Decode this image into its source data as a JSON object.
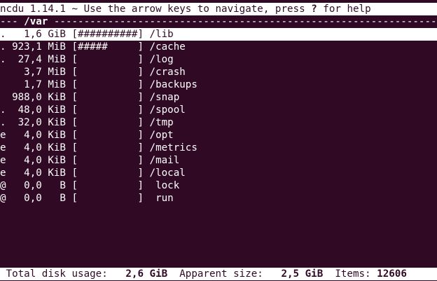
{
  "header": {
    "app": "ncdu 1.14.1",
    "sep": " ~ ",
    "hint_prefix": "Use the arrow keys to navigate, press ",
    "help_key": "?",
    "hint_suffix": " for help"
  },
  "path_bar": {
    "lead": "--- ",
    "path": "/var",
    "trail": " -------------------------------------------------------------------"
  },
  "entries": [
    {
      "flag": ".",
      "size": "  1,6 GiB",
      "bar": "[##########]",
      "name": " /lib"
    },
    {
      "flag": ".",
      "size": "923,1 MiB",
      "bar": "[#####     ]",
      "name": " /cache"
    },
    {
      "flag": ".",
      "size": " 27,4 MiB",
      "bar": "[          ]",
      "name": " /log"
    },
    {
      "flag": " ",
      "size": "  3,7 MiB",
      "bar": "[          ]",
      "name": " /crash"
    },
    {
      "flag": " ",
      "size": "  1,7 MiB",
      "bar": "[          ]",
      "name": " /backups"
    },
    {
      "flag": " ",
      "size": "988,0 KiB",
      "bar": "[          ]",
      "name": " /snap"
    },
    {
      "flag": ".",
      "size": " 48,0 KiB",
      "bar": "[          ]",
      "name": " /spool"
    },
    {
      "flag": ".",
      "size": " 32,0 KiB",
      "bar": "[          ]",
      "name": " /tmp"
    },
    {
      "flag": "e",
      "size": "  4,0 KiB",
      "bar": "[          ]",
      "name": " /opt"
    },
    {
      "flag": "e",
      "size": "  4,0 KiB",
      "bar": "[          ]",
      "name": " /metrics"
    },
    {
      "flag": "e",
      "size": "  4,0 KiB",
      "bar": "[          ]",
      "name": " /mail"
    },
    {
      "flag": "e",
      "size": "  4,0 KiB",
      "bar": "[          ]",
      "name": " /local"
    },
    {
      "flag": "@",
      "size": "  0,0   B",
      "bar": "[          ]",
      "name": "  lock"
    },
    {
      "flag": "@",
      "size": "  0,0   B",
      "bar": "[          ]",
      "name": "  run"
    }
  ],
  "status": {
    "total_label": " Total disk usage:",
    "total_value": "   2,6 GiB",
    "apparent_label": "  Apparent size:",
    "apparent_value": "   2,5 GiB",
    "items_label": "  Items:",
    "items_value": " 12606"
  },
  "colors": {
    "background": "#300a24",
    "foreground": "#ffffff"
  }
}
